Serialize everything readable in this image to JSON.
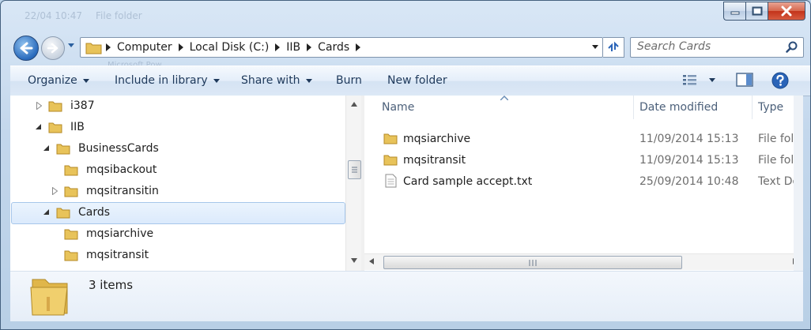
{
  "window": {
    "bg_ghost_texts": [
      "22/04 10:47",
      "File folder",
      "Microsoft Pow"
    ],
    "caption": {
      "minimize": "minimize",
      "maximize": "maximize",
      "close": "close"
    }
  },
  "address": {
    "crumbs": [
      "Computer",
      "Local Disk (C:)",
      "IIB",
      "Cards"
    ]
  },
  "search": {
    "placeholder": "Search Cards"
  },
  "toolbar": {
    "organize": "Organize",
    "include_in_library": "Include in library",
    "share_with": "Share with",
    "burn": "Burn",
    "new_folder": "New folder"
  },
  "tree": {
    "items": [
      {
        "label": "i387",
        "expander": "collapsed"
      },
      {
        "label": "IIB",
        "expander": "expanded"
      },
      {
        "label": "BusinessCards",
        "expander": "expanded"
      },
      {
        "label": "mqsibackout",
        "expander": "none"
      },
      {
        "label": "mqsitransitin",
        "expander": "collapsed"
      },
      {
        "label": "Cards",
        "expander": "expanded",
        "selected": true
      },
      {
        "label": "mqsiarchive",
        "expander": "none"
      },
      {
        "label": "mqsitransit",
        "expander": "none"
      }
    ]
  },
  "files": {
    "columns": [
      "Name",
      "Date modified",
      "Type"
    ],
    "rows": [
      {
        "name": "mqsiarchive",
        "date": "11/09/2014 15:13",
        "type": "File folde",
        "icon": "folder-icon"
      },
      {
        "name": "mqsitransit",
        "date": "11/09/2014 15:13",
        "type": "File folde",
        "icon": "folder-icon"
      },
      {
        "name": "Card sample accept.txt",
        "date": "25/09/2014 10:48",
        "type": "Text Doc",
        "icon": "text-file-icon"
      }
    ]
  },
  "details": {
    "count": "3 items"
  },
  "colors": {
    "accent": "#1e395b",
    "selection": "#dbeafc",
    "folder": "#e8c35a",
    "help": "#2a64b8"
  }
}
